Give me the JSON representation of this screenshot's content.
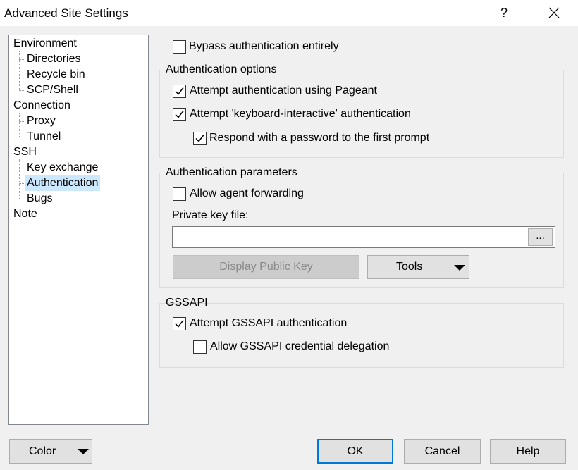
{
  "window": {
    "title": "Advanced Site Settings",
    "help_glyph": "?"
  },
  "tree": {
    "items": [
      {
        "label": "Environment"
      },
      {
        "label": "Directories"
      },
      {
        "label": "Recycle bin"
      },
      {
        "label": "SCP/Shell"
      },
      {
        "label": "Connection"
      },
      {
        "label": "Proxy"
      },
      {
        "label": "Tunnel"
      },
      {
        "label": "SSH"
      },
      {
        "label": "Key exchange"
      },
      {
        "label": "Authentication",
        "selected": true
      },
      {
        "label": "Bugs"
      },
      {
        "label": "Note"
      }
    ]
  },
  "bypass": {
    "label": "Bypass authentication entirely",
    "checked": false
  },
  "auth_options": {
    "title": "Authentication options",
    "pageant": {
      "label": "Attempt authentication using Pageant",
      "checked": true
    },
    "kbd": {
      "label": "Attempt 'keyboard-interactive' authentication",
      "checked": true
    },
    "respond": {
      "label": "Respond with a password to the first prompt",
      "checked": true
    }
  },
  "auth_params": {
    "title": "Authentication parameters",
    "agent_forwarding": {
      "label": "Allow agent forwarding",
      "checked": false
    },
    "private_key_label": "Private key file:",
    "private_key_value": "",
    "browse_label": "...",
    "display_public_key": "Display Public Key",
    "tools": "Tools"
  },
  "gssapi": {
    "title": "GSSAPI",
    "attempt": {
      "label": "Attempt GSSAPI authentication",
      "checked": true
    },
    "delegation": {
      "label": "Allow GSSAPI credential delegation",
      "checked": false
    }
  },
  "footer": {
    "color": "Color",
    "ok": "OK",
    "cancel": "Cancel",
    "help": "Help"
  }
}
